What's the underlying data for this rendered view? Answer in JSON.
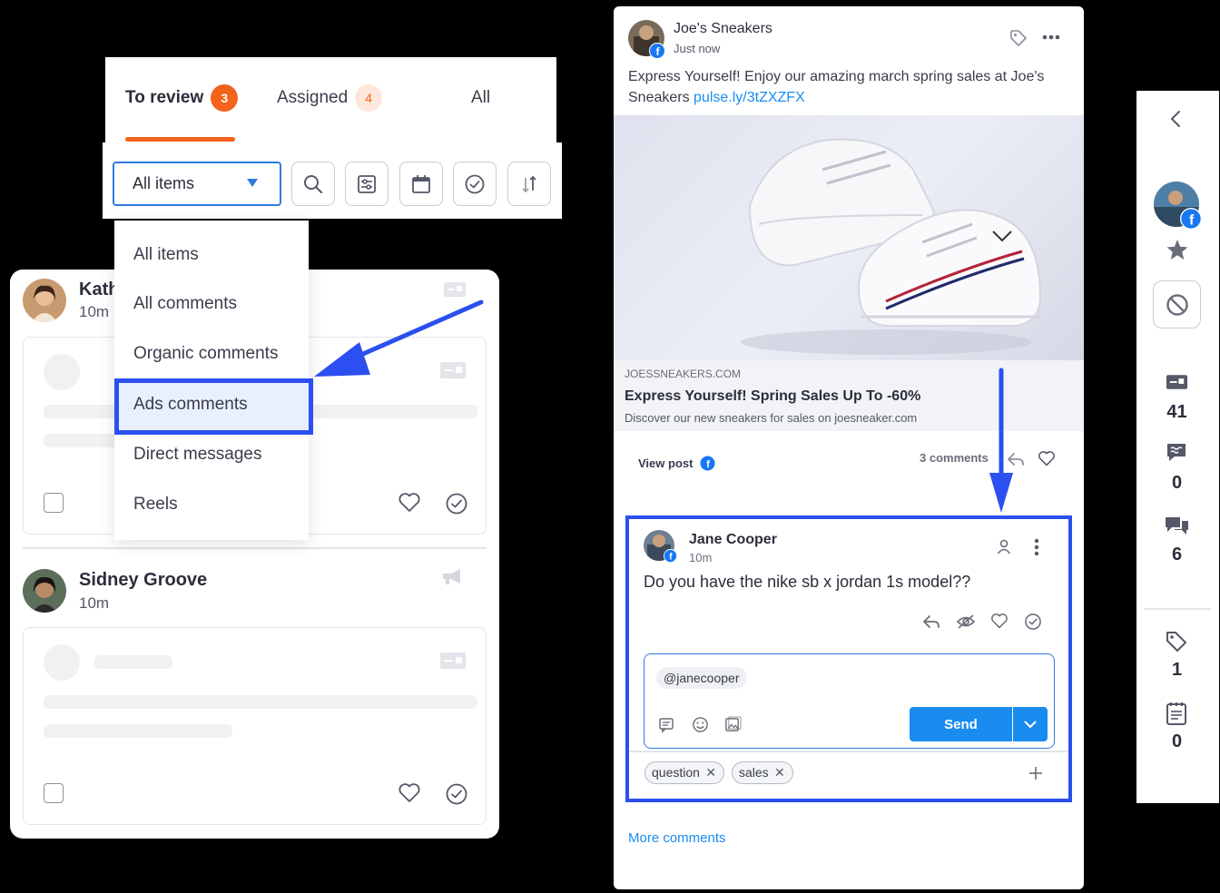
{
  "tabs": [
    {
      "label": "To review",
      "count": "3"
    },
    {
      "label": "Assigned",
      "count": "4"
    },
    {
      "label": "All"
    }
  ],
  "toolbar": {
    "filter_value": "All items",
    "tools": [
      "search-icon",
      "filter-sliders-icon",
      "calendar-icon",
      "check-circle-icon",
      "sort-icon"
    ]
  },
  "dropdown": {
    "items": [
      "All items",
      "All comments",
      "Organic comments",
      "Ads comments",
      "Direct messages",
      "Reels"
    ],
    "highlighted": "Ads comments"
  },
  "inbox": {
    "items": [
      {
        "name": "Kath",
        "time": "10m"
      },
      {
        "name": "Sidney Groove",
        "time": "10m"
      }
    ]
  },
  "post": {
    "author": "Joe's Sneakers",
    "time": "Just now",
    "text_line1": "Express Yourself!  Enjoy our amazing march spring sales at Joe's",
    "text_line2": "Sneakers",
    "link": "pulse.ly/3tZXZFX",
    "preview_domain": "JOESSNEAKERS.COM",
    "preview_title": "Express Yourself! Spring Sales Up To -60%",
    "preview_desc": "Discover our new sneakers for sales on joesneaker.com",
    "view_post": "View post",
    "comments_count": "3 comments",
    "more_comments": "More comments"
  },
  "comment": {
    "author": "Jane Cooper",
    "time": "10m",
    "text": "Do you have the nike sb x jordan 1s model??",
    "reply_mention": "@janecooper",
    "send_label": "Send",
    "tags": [
      "question",
      "sales"
    ]
  },
  "rail": {
    "counts": {
      "ads": "41",
      "reviews": "0",
      "messages": "6",
      "tags": "1",
      "notes": "0"
    }
  },
  "colors": {
    "accent_orange": "#f3631b",
    "accent_blue": "#1a8cf0",
    "highlight_blue": "#2b4ff0",
    "facebook_blue": "#1877f2"
  }
}
